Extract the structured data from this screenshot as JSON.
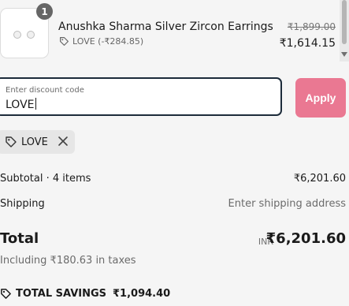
{
  "line_item": {
    "title": "Anushka Sharma Silver Zircon Earrings",
    "quantity": "1",
    "discount_note": "LOVE (-₹284.85)",
    "original_price": "₹1,899.00",
    "price": "₹1,614.15"
  },
  "discount": {
    "label": "Enter discount code",
    "value": "LOVE",
    "apply_label": "Apply",
    "applied_code": "LOVE"
  },
  "summary": {
    "subtotal_label": "Subtotal · 4 items",
    "subtotal_value": "₹6,201.60",
    "shipping_label": "Shipping",
    "shipping_value": "Enter shipping address",
    "total_label": "Total",
    "currency": "INR",
    "total_value": "₹6,201.60",
    "tax_note": "Including ₹180.63 in taxes",
    "savings_label": "TOTAL SAVINGS",
    "savings_value": "₹1,094.40"
  },
  "colors": {
    "apply_button": "#ea7892",
    "input_border": "#1c2b3a",
    "chip_background": "#e6e6e6",
    "badge": "#666666"
  },
  "icons": [
    "tag-icon",
    "close-icon",
    "savings-tag-icon",
    "scroll-down-arrow-icon"
  ]
}
